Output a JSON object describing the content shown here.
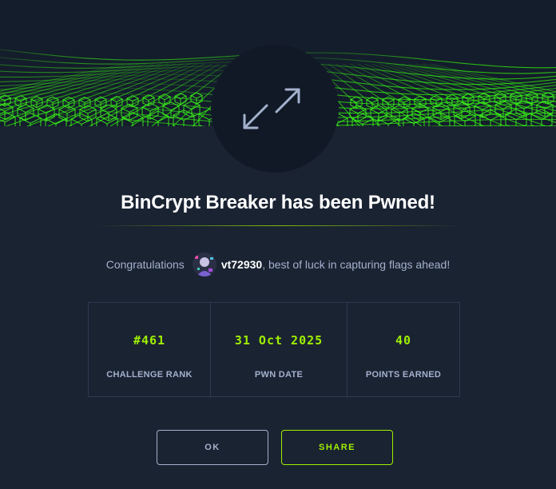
{
  "modal": {
    "title": "BinCrypt Breaker has been Pwned!",
    "badge_icon": "expand-arrows-icon",
    "banner": "green-wireframe-wave"
  },
  "congrats": {
    "prefix": "Congratulations",
    "username": "vt72930",
    "suffix": ", best of luck in capturing flags ahead!",
    "avatar_icon": "user-avatar"
  },
  "stats": [
    {
      "value": "#461",
      "label": "CHALLENGE RANK"
    },
    {
      "value": "31 Oct 2025",
      "label": "PWN DATE"
    },
    {
      "value": "40",
      "label": "POINTS EARNED"
    }
  ],
  "buttons": {
    "ok_label": "OK",
    "share_label": "SHARE"
  },
  "colors": {
    "background": "#1a2332",
    "accent": "#9fef00",
    "muted_text": "#a4b1cd",
    "badge_bg": "#111927",
    "border": "#2c3a4f"
  }
}
